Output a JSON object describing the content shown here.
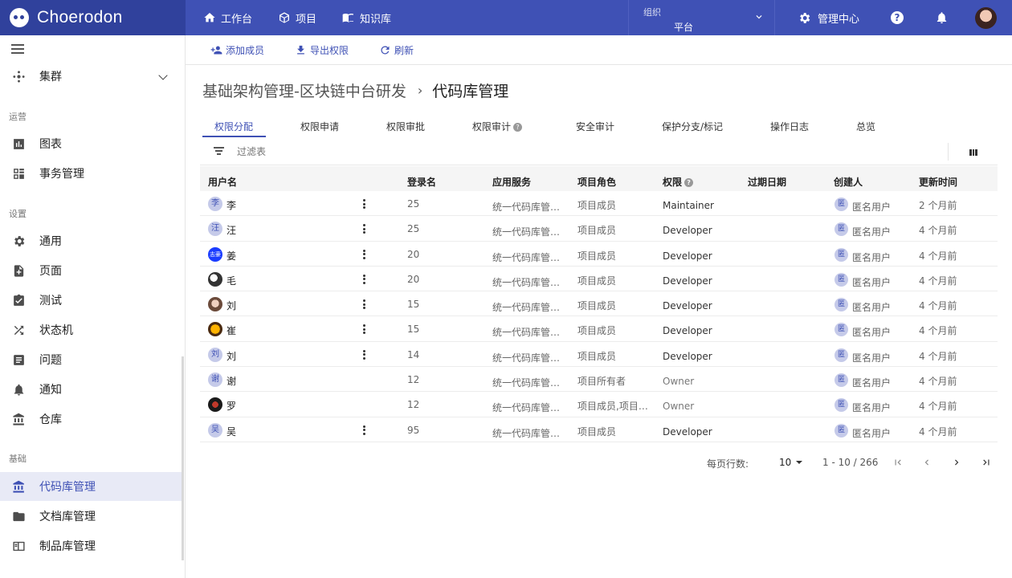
{
  "brand": {
    "name": "Choerodon"
  },
  "topnav": [
    {
      "label": "工作台",
      "icon": "home-icon"
    },
    {
      "label": "项目",
      "icon": "cube-icon"
    },
    {
      "label": "知识库",
      "icon": "book-icon"
    }
  ],
  "org": {
    "label": "组织",
    "value": "平台"
  },
  "header": {
    "management_label": "管理中心",
    "help": "?"
  },
  "sidebar": {
    "top_item": "集群",
    "groups": [
      {
        "title": "运营",
        "items": [
          "图表",
          "事务管理"
        ]
      },
      {
        "title": "设置",
        "items": [
          "通用",
          "页面",
          "测试",
          "状态机",
          "问题",
          "通知",
          "仓库"
        ]
      },
      {
        "title": "基础",
        "items": [
          "代码库管理",
          "文档库管理",
          "制品库管理"
        ]
      }
    ],
    "active": "代码库管理"
  },
  "toolbar": {
    "add_member": "添加成员",
    "export": "导出权限",
    "refresh": "刷新"
  },
  "breadcrumb": {
    "parent": "基础架构管理-区块链中台研发",
    "separator": "›",
    "current": "代码库管理"
  },
  "tabs": [
    "权限分配",
    "权限申请",
    "权限审批",
    "权限审计",
    "安全审计",
    "保护分支/标记",
    "操作日志",
    "总览"
  ],
  "filter": {
    "placeholder": "过滤表"
  },
  "table": {
    "headers": [
      "用户名",
      "登录名",
      "应用服务",
      "项目角色",
      "权限",
      "过期日期",
      "创建人",
      "更新时间"
    ],
    "rows": [
      {
        "avatar": "李",
        "name": "李",
        "login": "25",
        "service": "统一代码库管…",
        "role": "项目成员",
        "perm": "Maintainer",
        "creator_avatar": "匿",
        "creator": "匿名用户",
        "updated": "2 个月前",
        "menu": true
      },
      {
        "avatar": "汪",
        "name": "汪",
        "login": "25",
        "service": "统一代码库管…",
        "role": "项目成员",
        "perm": "Developer",
        "creator_avatar": "匿",
        "creator": "匿名用户",
        "updated": "4 个月前",
        "menu": true
      },
      {
        "avatar": "志豪",
        "name": "姜",
        "login": "20",
        "service": "统一代码库管…",
        "role": "项目成员",
        "perm": "Developer",
        "creator_avatar": "匿",
        "creator": "匿名用户",
        "updated": "4 个月前",
        "menu": true
      },
      {
        "avatar": "",
        "name": "毛",
        "login": "20",
        "service": "统一代码库管…",
        "role": "项目成员",
        "perm": "Developer",
        "creator_avatar": "匿",
        "creator": "匿名用户",
        "updated": "4 个月前",
        "menu": true
      },
      {
        "avatar": "",
        "name": "刘",
        "login": "15",
        "service": "统一代码库管…",
        "role": "项目成员",
        "perm": "Developer",
        "creator_avatar": "匿",
        "creator": "匿名用户",
        "updated": "4 个月前",
        "menu": true
      },
      {
        "avatar": "",
        "name": "崔",
        "login": "15",
        "service": "统一代码库管…",
        "role": "项目成员",
        "perm": "Developer",
        "creator_avatar": "匿",
        "creator": "匿名用户",
        "updated": "4 个月前",
        "menu": true
      },
      {
        "avatar": "刘",
        "name": "刘",
        "login": "14",
        "service": "统一代码库管…",
        "role": "项目成员",
        "perm": "Developer",
        "creator_avatar": "匿",
        "creator": "匿名用户",
        "updated": "4 个月前",
        "menu": true
      },
      {
        "avatar": "谢",
        "name": "谢",
        "login": "12",
        "service": "统一代码库管…",
        "role": "项目所有者",
        "perm": "Owner",
        "creator_avatar": "匿",
        "creator": "匿名用户",
        "updated": "4 个月前",
        "menu": false
      },
      {
        "avatar": "",
        "name": "罗",
        "login": "12",
        "service": "统一代码库管…",
        "role": "项目成员,项目…",
        "perm": "Owner",
        "creator_avatar": "匿",
        "creator": "匿名用户",
        "updated": "4 个月前",
        "menu": false
      },
      {
        "avatar": "吴",
        "name": "吴",
        "login": "95",
        "service": "统一代码库管…",
        "role": "项目成员",
        "perm": "Developer",
        "creator_avatar": "匿",
        "creator": "匿名用户",
        "updated": "4 个月前",
        "menu": true
      }
    ]
  },
  "pagination": {
    "rows_per_page_label": "每页行数:",
    "page_size": "10",
    "range": "1 - 10 / 266"
  },
  "colors": {
    "primary": "#3f51b5",
    "brand_bg": "#30419c",
    "active_bg": "#e8eaf6"
  }
}
